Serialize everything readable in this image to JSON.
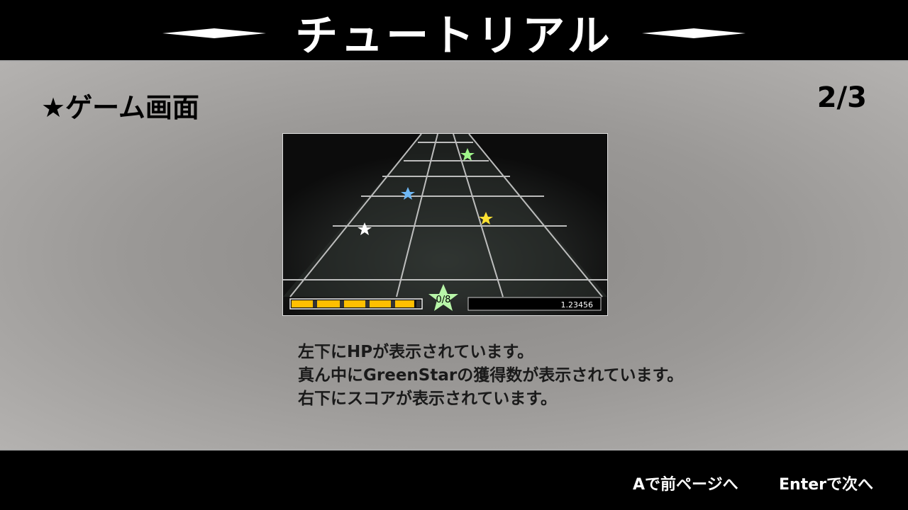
{
  "header": {
    "title": "チュートリアル"
  },
  "panel": {
    "heading": "★ゲーム画面",
    "page_indicator": "2/3"
  },
  "game_preview": {
    "green_star_count": "0/8",
    "score": "1.23456",
    "hp_fraction": 0.95,
    "colors": {
      "hp": "#ffbf00",
      "green_star": "#b8f5a8"
    }
  },
  "description": [
    "左下にHPが表示されています。",
    "真ん中にGreenStarの獲得数が表示されています。",
    "右下にスコアが表示されています。"
  ],
  "footer": {
    "prev_label": "Aで前ページへ",
    "next_label": "Enterで次へ"
  }
}
